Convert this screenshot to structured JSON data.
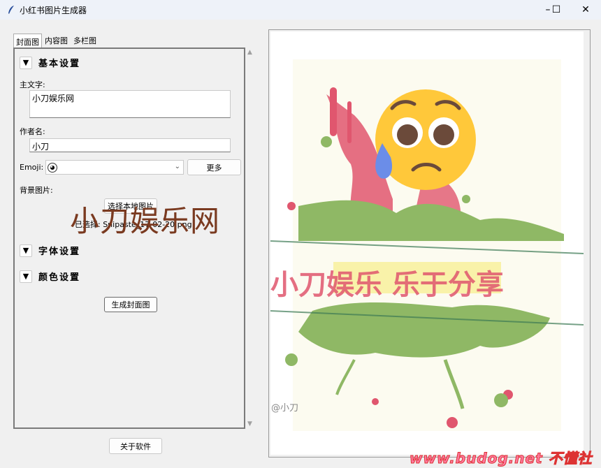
{
  "window": {
    "title": "小红书图片生成器",
    "controls": {
      "minimize": "–",
      "maximize": "☐",
      "close": "✕"
    }
  },
  "tabs": [
    {
      "label": "封面图",
      "active": true
    },
    {
      "label": "内容图",
      "active": false
    },
    {
      "label": "多栏图",
      "active": false
    }
  ],
  "basic": {
    "toggle": "▼",
    "title": "基本设置",
    "main_text_label": "主文字:",
    "main_text_value": "小刀娱乐网",
    "author_label": "作者名:",
    "author_value": "小刀",
    "emoji_label": "Emoji:",
    "emoji_value": "",
    "more_button": "更多",
    "bg_label": "背景图片:",
    "choose_button": "选择本地图片",
    "selected_file": "已选择: Snipaste_17-02-20.png"
  },
  "font_section": {
    "toggle": "▼",
    "title": "字体设置"
  },
  "color_section": {
    "toggle": "▼",
    "title": "颜色设置"
  },
  "generate_button": "生成封面图",
  "about_button": "关于软件",
  "scrollbar": {
    "up": "▲",
    "down": "▼"
  },
  "preview": {
    "title": "小刀娱乐网",
    "banner_text": "小刀娱乐  乐于分享",
    "author": "@小刀"
  },
  "watermark": "www.budog.net 不懂社区",
  "colors": {
    "title_brown": "#7a3a20",
    "splash_pink": "#e0566e",
    "splash_green": "#8fb865",
    "emoji_yellow": "#ffc83a",
    "watermark_pink": "#ff7aa0"
  }
}
